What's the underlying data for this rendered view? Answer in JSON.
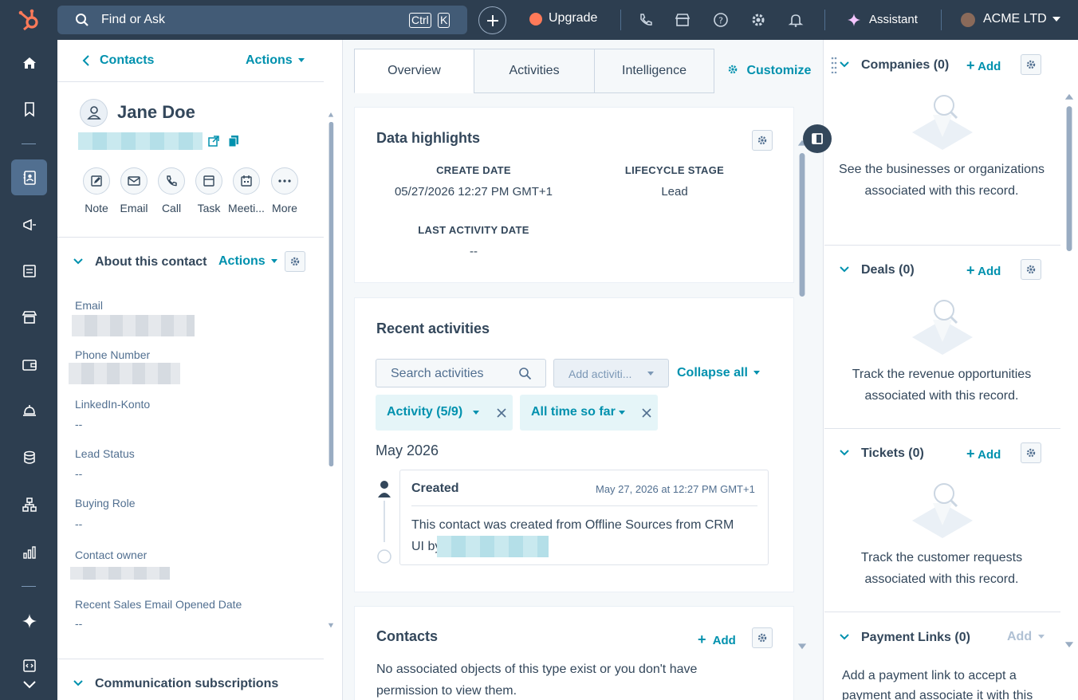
{
  "topbar": {
    "search_placeholder": "Find or Ask",
    "kbd_ctrl": "Ctrl",
    "kbd_k": "K",
    "upgrade_label": "Upgrade",
    "assistant_label": "Assistant",
    "account_name": "ACME LTD"
  },
  "leftnav": {
    "icons": [
      "home-icon",
      "bookmark-icon",
      "contacts-icon",
      "marketing-icon",
      "content-icon",
      "commerce-icon",
      "payments-icon",
      "service-icon",
      "data-icon",
      "automation-icon",
      "reporting-icon",
      "ai-sparkle-icon",
      "dev-icon",
      "expand-icon"
    ]
  },
  "contact": {
    "back_label": "Contacts",
    "actions_label": "Actions",
    "name": "Jane Doe",
    "quick_actions": [
      "Note",
      "Email",
      "Call",
      "Task",
      "Meeti...",
      "More"
    ]
  },
  "about": {
    "title": "About this contact",
    "actions_label": "Actions",
    "props": [
      {
        "label": "Email",
        "value": ""
      },
      {
        "label": "Phone Number",
        "value": ""
      },
      {
        "label": "LinkedIn-Konto",
        "value": "--"
      },
      {
        "label": "Lead Status",
        "value": "--"
      },
      {
        "label": "Buying Role",
        "value": "--"
      },
      {
        "label": "Contact owner",
        "value": ""
      },
      {
        "label": "Recent Sales Email Opened Date",
        "value": "--"
      }
    ],
    "next_section": "Communication subscriptions"
  },
  "tabs": [
    "Overview",
    "Activities",
    "Intelligence"
  ],
  "customize_label": "Customize",
  "highlights": {
    "title": "Data highlights",
    "items": [
      {
        "label": "CREATE DATE",
        "value": "05/27/2026 12:27 PM GMT+1"
      },
      {
        "label": "LIFECYCLE STAGE",
        "value": "Lead"
      },
      {
        "label": "LAST ACTIVITY DATE",
        "value": "--"
      }
    ]
  },
  "recent": {
    "title": "Recent activities",
    "search_placeholder": "Search activities",
    "add_activity": "Add activiti...",
    "collapse_all": "Collapse all",
    "chip_activity": "Activity (5/9)",
    "chip_time": "All time so far",
    "month": "May 2026",
    "event_title": "Created",
    "event_time": "May 27, 2026 at 12:27 PM GMT+1",
    "event_body_1": "This contact was created from Offline Sources from CRM",
    "event_body_2": "UI by"
  },
  "contacts_card": {
    "title": "Contacts",
    "add_label": "Add",
    "body_1": "No associated objects of this type exist or you don't have",
    "body_2": "permission to view them."
  },
  "right": {
    "companies_title": "Companies (0)",
    "companies_desc": "See the businesses or organizations associated with this record.",
    "deals_title": "Deals (0)",
    "deals_desc": "Track the revenue opportunities associated with this record.",
    "tickets_title": "Tickets (0)",
    "tickets_desc": "Track the customer requests associated with this record.",
    "payment_title": "Payment Links (0)",
    "payment_desc": "Add a payment link to accept a payment and associate it with this",
    "add_label": "Add"
  },
  "colors": {
    "nav_bg": "#2d3e50",
    "accent": "#0091ae",
    "text": "#33475b"
  }
}
